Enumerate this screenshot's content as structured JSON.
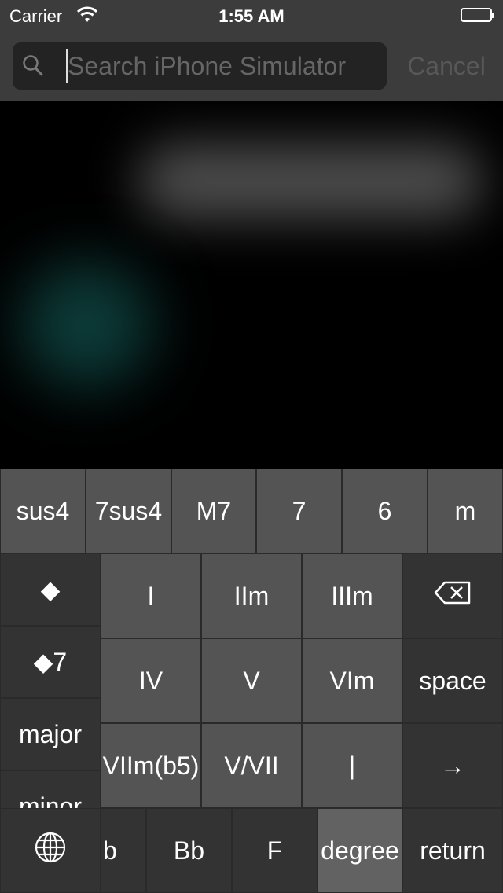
{
  "status_bar": {
    "carrier": "Carrier",
    "time": "1:55 AM",
    "wifi_icon": "wifi-icon",
    "battery_icon": "battery-icon",
    "battery_level": 1.0
  },
  "search": {
    "placeholder": "Search iPhone Simulator",
    "value": "",
    "cancel_label": "Cancel",
    "icon": "search-icon"
  },
  "keyboard": {
    "quality_row": [
      "sus4",
      "7sus4",
      "M7",
      "7",
      "6",
      "m"
    ],
    "side_panel": [
      "◆",
      "◆7",
      "major",
      "minor"
    ],
    "degree_grid": [
      [
        "I",
        "IIm",
        "IIIm"
      ],
      [
        "IV",
        "V",
        "VIm"
      ],
      [
        "VIIm(b5)",
        "V/VII",
        "|"
      ]
    ],
    "right_column": {
      "delete_icon": "backspace-icon",
      "space_label": "space",
      "arrow_label": "→"
    },
    "bottom_row": {
      "globe_icon": "globe-icon",
      "keys": [
        "b",
        "Bb",
        "F",
        "degree"
      ],
      "return_label": "return"
    }
  },
  "colors": {
    "bar_bg": "#3c3c3c",
    "field_bg": "#232323",
    "key_light": "#545454",
    "key_dark": "#333333",
    "key_selected": "#626262"
  }
}
